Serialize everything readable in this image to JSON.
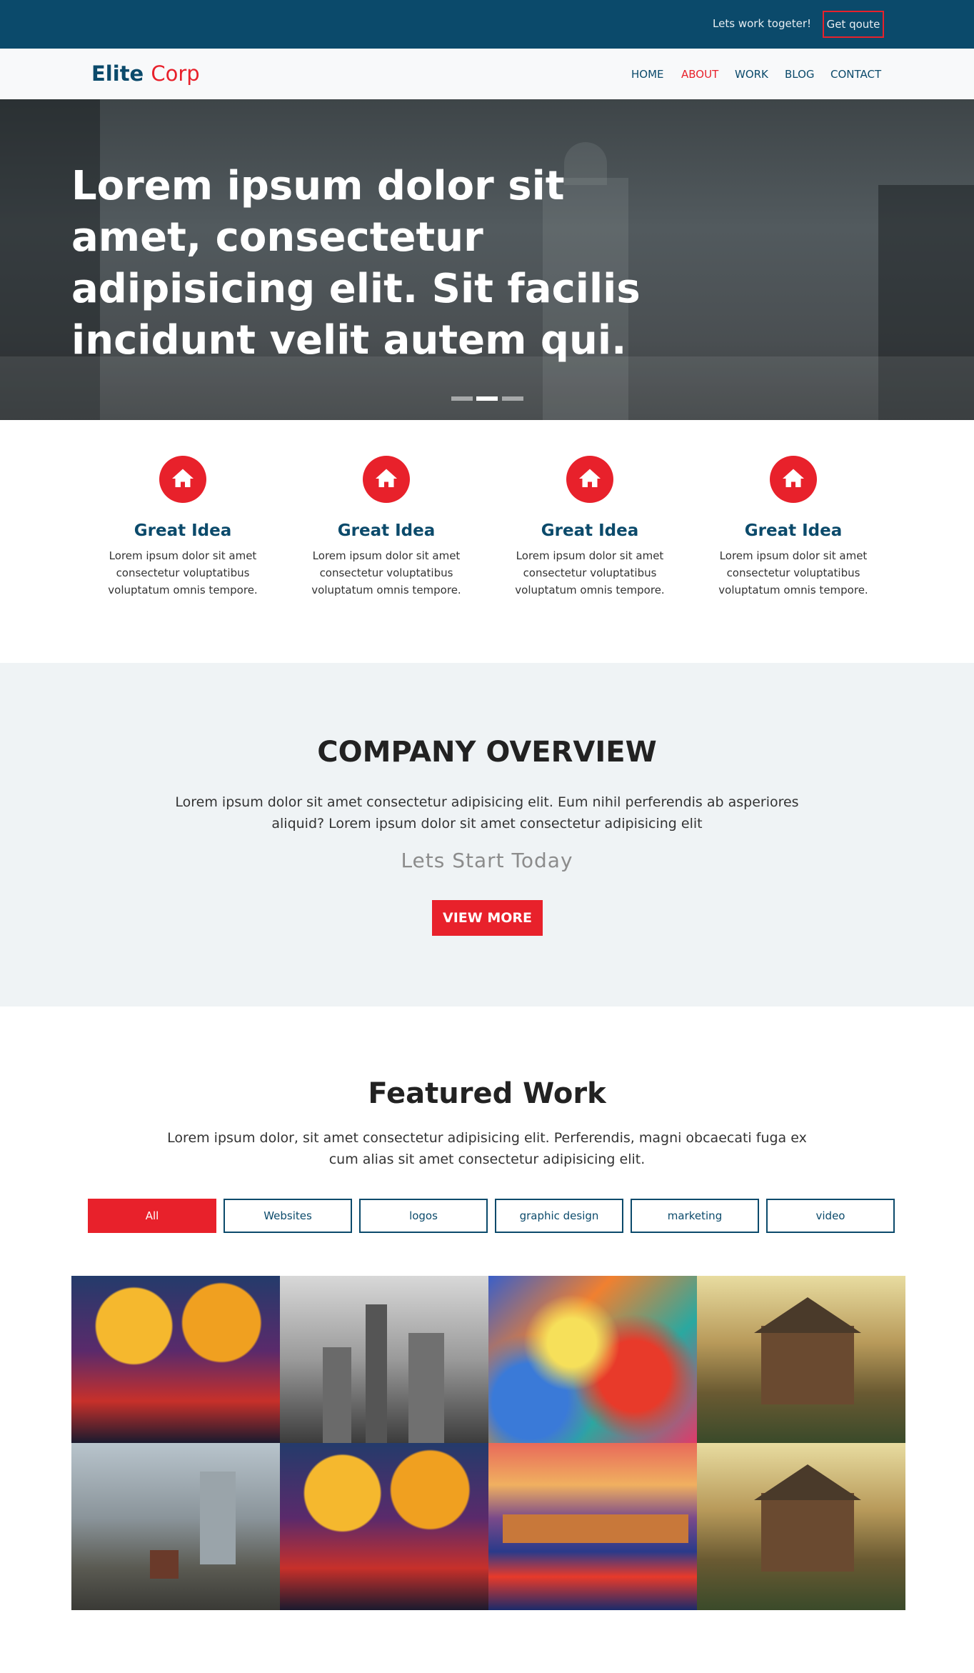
{
  "topbar": {
    "tagline": "Lets work togeter!",
    "quote_label": "Get qoute"
  },
  "brand": {
    "part1": "Elite",
    "part2": "Corp"
  },
  "nav": {
    "home": "HOME",
    "about": "ABOUT",
    "work": "WORK",
    "blog": "BLOG",
    "contact": "CONTACT"
  },
  "hero": {
    "headline": "Lorem ipsum dolor sit amet, consectetur adipisicing elit. Sit facilis incidunt velit autem qui.",
    "active_slide": 2,
    "slide_count": 3
  },
  "features": [
    {
      "icon": "home-icon",
      "title": "Great Idea",
      "text": "Lorem ipsum dolor sit amet consectetur voluptatibus voluptatum omnis tempore."
    },
    {
      "icon": "home-icon",
      "title": "Great Idea",
      "text": "Lorem ipsum dolor sit amet consectetur voluptatibus voluptatum omnis tempore."
    },
    {
      "icon": "home-icon",
      "title": "Great Idea",
      "text": "Lorem ipsum dolor sit amet consectetur voluptatibus voluptatum omnis tempore."
    },
    {
      "icon": "home-icon",
      "title": "Great Idea",
      "text": "Lorem ipsum dolor sit amet consectetur voluptatibus voluptatum omnis tempore."
    }
  ],
  "overview": {
    "title": "COMPANY OVERVIEW",
    "text": "Lorem ipsum dolor sit amet consectetur adipisicing elit. Eum nihil perferendis ab asperiores aliquid? Lorem ipsum dolor sit amet consectetur adipisicing elit",
    "tagline": "Lets Start Today",
    "button": "VIEW MORE"
  },
  "featured": {
    "title": "Featured Work",
    "text": "Lorem ipsum dolor, sit amet consectetur adipisicing elit. Perferendis, magni obcaecati fuga ex cum alias sit amet consectetur adipisicing elit.",
    "filters": [
      "All",
      "Websites",
      "logos",
      "graphic design",
      "marketing",
      "video"
    ],
    "selected_filter": "All"
  },
  "colors": {
    "primary": "#0b4a6b",
    "accent": "#e8212b",
    "section_bg": "#eff3f5"
  }
}
